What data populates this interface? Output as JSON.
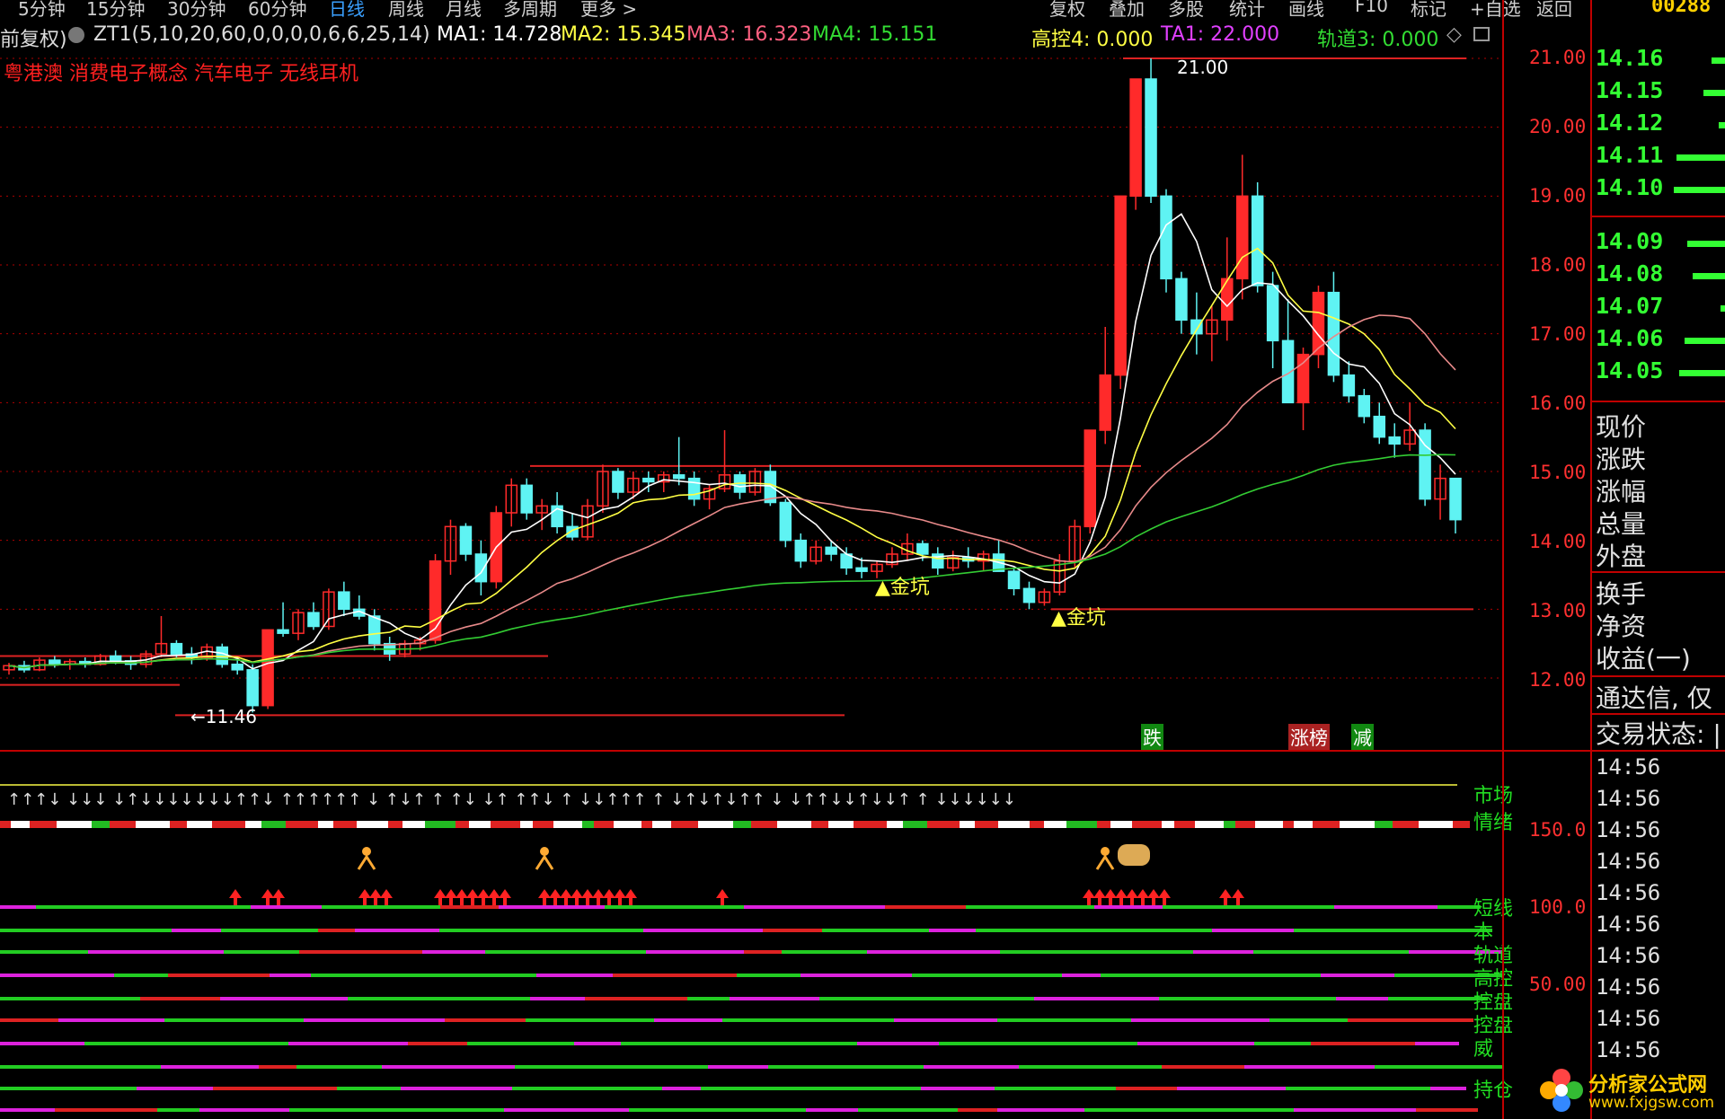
{
  "toolbar": {
    "period_tabs": [
      "5分钟",
      "15分钟",
      "30分钟",
      "60分钟",
      "日线",
      "周线",
      "月线",
      "多周期",
      "更多 >"
    ],
    "active_tab": "日线",
    "right_buttons": [
      "复权",
      "叠加",
      "多股",
      "统计",
      "画线",
      "F10",
      "标记",
      "+自选",
      "返回"
    ],
    "stock_code": "00288"
  },
  "info": {
    "adjust": "前复权)",
    "indicator": "ZT1(5,10,20,60,0,0,0,0,6,6,25,14)",
    "ma1": "MA1: 14.728",
    "ma2": "MA2: 15.345",
    "ma3": "MA3: 16.323",
    "ma4": "MA4: 15.151",
    "gaokong": "高控4: 0.000",
    "ta1": "TA1: 22.000",
    "guidao": "轨道3: 0.000",
    "concepts": "粤港澳  消费电子概念  汽车电子  无线耳机"
  },
  "chart_annotations": {
    "high_label": "21.00",
    "low_label": "←11.46",
    "gold_pit": "金坑",
    "events": [
      "跌",
      "涨榜",
      "减"
    ]
  },
  "price_axis": [
    "21.00",
    "20.00",
    "19.00",
    "18.00",
    "17.00",
    "16.00",
    "15.00",
    "14.00",
    "13.00",
    "12.00"
  ],
  "indicator_axis": [
    "150.0",
    "100.0",
    "50.00"
  ],
  "indicator_labels": [
    "市场",
    "情绪",
    "短线",
    "本",
    "轨道",
    "高控",
    "控盘",
    "控盘",
    "威",
    "持仓"
  ],
  "orderbook": [
    {
      "price": "14.16",
      "bar": 0.25
    },
    {
      "price": "14.15",
      "bar": 0.4
    },
    {
      "price": "14.12",
      "bar": 0.12
    },
    {
      "price": "14.11",
      "bar": 0.9
    },
    {
      "price": "14.10",
      "bar": 0.95
    },
    {
      "price": "14.09",
      "bar": 0.7
    },
    {
      "price": "14.08",
      "bar": 0.6
    },
    {
      "price": "14.07",
      "bar": 0.08
    },
    {
      "price": "14.06",
      "bar": 0.75
    },
    {
      "price": "14.05",
      "bar": 0.85
    }
  ],
  "quote_labels": [
    "现价",
    "涨跌",
    "涨幅",
    "总量",
    "外盘",
    "换手",
    "净资",
    "收益(一)",
    "通达信, 仅",
    "交易状态: |"
  ],
  "trade_times": [
    "14:56",
    "14:56",
    "14:56",
    "14:56",
    "14:56",
    "14:56",
    "14:56",
    "14:56",
    "14:56",
    "14:56"
  ],
  "logo": {
    "name": "分析家公式网",
    "url": "www.fxjgsw.com"
  },
  "colors": {
    "up": "#ff2a2a",
    "down": "#5ff3f3",
    "ma_white": "#ffffff",
    "ma_yellow": "#ffff44",
    "ma_pink": "#e88a8a",
    "ma_green": "#33cc33",
    "grid": "#b00000"
  },
  "chart_data": {
    "type": "candlestick",
    "ylim": [
      11.4,
      21.3
    ],
    "candles": [
      [
        12.12,
        12.22,
        12.05,
        12.18
      ],
      [
        12.18,
        12.25,
        12.08,
        12.12
      ],
      [
        12.12,
        12.3,
        12.1,
        12.26
      ],
      [
        12.26,
        12.32,
        12.15,
        12.2
      ],
      [
        12.2,
        12.28,
        12.12,
        12.24
      ],
      [
        12.24,
        12.3,
        12.15,
        12.2
      ],
      [
        12.2,
        12.35,
        12.18,
        12.32
      ],
      [
        12.32,
        12.4,
        12.2,
        12.25
      ],
      [
        12.25,
        12.32,
        12.12,
        12.2
      ],
      [
        12.2,
        12.4,
        12.15,
        12.35
      ],
      [
        12.35,
        12.9,
        12.3,
        12.5
      ],
      [
        12.5,
        12.55,
        12.3,
        12.35
      ],
      [
        12.35,
        12.45,
        12.2,
        12.3
      ],
      [
        12.3,
        12.5,
        12.25,
        12.45
      ],
      [
        12.45,
        12.5,
        12.15,
        12.2
      ],
      [
        12.2,
        12.3,
        12.05,
        12.12
      ],
      [
        12.12,
        12.2,
        11.5,
        11.6
      ],
      [
        11.6,
        12.7,
        11.55,
        12.7
      ],
      [
        12.7,
        13.1,
        12.6,
        12.65
      ],
      [
        12.65,
        13.0,
        12.55,
        12.95
      ],
      [
        12.95,
        13.1,
        12.7,
        12.75
      ],
      [
        12.75,
        13.3,
        12.7,
        13.25
      ],
      [
        13.25,
        13.4,
        12.9,
        13.0
      ],
      [
        13.0,
        13.2,
        12.85,
        12.9
      ],
      [
        12.9,
        13.0,
        12.4,
        12.5
      ],
      [
        12.5,
        12.6,
        12.25,
        12.35
      ],
      [
        12.35,
        12.55,
        12.3,
        12.5
      ],
      [
        12.5,
        12.6,
        12.4,
        12.55
      ],
      [
        12.55,
        13.8,
        12.5,
        13.7
      ],
      [
        13.7,
        14.3,
        13.5,
        14.2
      ],
      [
        14.2,
        14.25,
        13.7,
        13.8
      ],
      [
        13.8,
        14.0,
        13.2,
        13.4
      ],
      [
        13.4,
        14.5,
        13.3,
        14.4
      ],
      [
        14.4,
        14.9,
        14.2,
        14.8
      ],
      [
        14.8,
        14.9,
        14.3,
        14.4
      ],
      [
        14.4,
        14.6,
        14.15,
        14.5
      ],
      [
        14.5,
        14.7,
        14.1,
        14.2
      ],
      [
        14.2,
        14.4,
        14.0,
        14.05
      ],
      [
        14.05,
        14.6,
        14.0,
        14.5
      ],
      [
        14.5,
        15.1,
        14.4,
        15.0
      ],
      [
        15.0,
        15.05,
        14.6,
        14.7
      ],
      [
        14.7,
        15.0,
        14.6,
        14.9
      ],
      [
        14.9,
        15.0,
        14.7,
        14.85
      ],
      [
        14.85,
        15.0,
        14.7,
        14.95
      ],
      [
        14.95,
        15.5,
        14.8,
        14.9
      ],
      [
        14.9,
        15.0,
        14.5,
        14.6
      ],
      [
        14.6,
        14.8,
        14.45,
        14.75
      ],
      [
        14.75,
        15.6,
        14.7,
        14.95
      ],
      [
        14.95,
        15.0,
        14.6,
        14.7
      ],
      [
        14.7,
        15.05,
        14.65,
        15.0
      ],
      [
        15.0,
        15.1,
        14.5,
        14.55
      ],
      [
        14.55,
        14.6,
        13.9,
        14.0
      ],
      [
        14.0,
        14.1,
        13.6,
        13.7
      ],
      [
        13.7,
        14.0,
        13.65,
        13.9
      ],
      [
        13.9,
        14.0,
        13.7,
        13.8
      ],
      [
        13.8,
        13.9,
        13.5,
        13.6
      ],
      [
        13.6,
        13.75,
        13.45,
        13.55
      ],
      [
        13.55,
        13.7,
        13.45,
        13.65
      ],
      [
        13.65,
        13.9,
        13.6,
        13.8
      ],
      [
        13.8,
        14.1,
        13.7,
        13.95
      ],
      [
        13.95,
        14.0,
        13.7,
        13.8
      ],
      [
        13.8,
        13.9,
        13.5,
        13.6
      ],
      [
        13.6,
        13.85,
        13.55,
        13.75
      ],
      [
        13.75,
        13.9,
        13.6,
        13.7
      ],
      [
        13.7,
        13.85,
        13.55,
        13.8
      ],
      [
        13.8,
        14.0,
        13.7,
        13.55
      ],
      [
        13.55,
        13.6,
        13.2,
        13.3
      ],
      [
        13.3,
        13.4,
        13.0,
        13.1
      ],
      [
        13.1,
        13.3,
        13.05,
        13.25
      ],
      [
        13.25,
        13.8,
        13.2,
        13.7
      ],
      [
        13.7,
        14.3,
        13.6,
        14.2
      ],
      [
        14.2,
        15.6,
        14.1,
        15.6
      ],
      [
        15.6,
        17.1,
        15.4,
        16.4
      ],
      [
        16.4,
        19.0,
        16.2,
        19.0
      ],
      [
        19.0,
        20.7,
        18.8,
        20.7
      ],
      [
        20.7,
        21.0,
        18.9,
        19.0
      ],
      [
        19.0,
        19.1,
        17.6,
        17.8
      ],
      [
        17.8,
        17.9,
        17.0,
        17.2
      ],
      [
        17.2,
        17.6,
        16.7,
        17.0
      ],
      [
        17.0,
        17.4,
        16.6,
        17.2
      ],
      [
        17.2,
        18.4,
        16.9,
        17.8
      ],
      [
        17.8,
        19.6,
        17.5,
        19.0
      ],
      [
        19.0,
        19.2,
        17.6,
        17.7
      ],
      [
        17.7,
        17.9,
        16.5,
        16.9
      ],
      [
        16.9,
        17.5,
        16.3,
        16.0
      ],
      [
        16.0,
        16.8,
        15.6,
        16.7
      ],
      [
        16.7,
        17.7,
        16.5,
        17.6
      ],
      [
        17.6,
        17.9,
        16.3,
        16.4
      ],
      [
        16.4,
        16.6,
        16.0,
        16.1
      ],
      [
        16.1,
        16.2,
        15.7,
        15.8
      ],
      [
        15.8,
        16.0,
        15.4,
        15.5
      ],
      [
        15.5,
        15.7,
        15.2,
        15.4
      ],
      [
        15.4,
        16.0,
        15.3,
        15.6
      ],
      [
        15.6,
        15.7,
        14.5,
        14.6
      ],
      [
        14.6,
        15.1,
        14.3,
        14.9
      ],
      [
        14.9,
        14.9,
        14.1,
        14.3
      ]
    ]
  }
}
